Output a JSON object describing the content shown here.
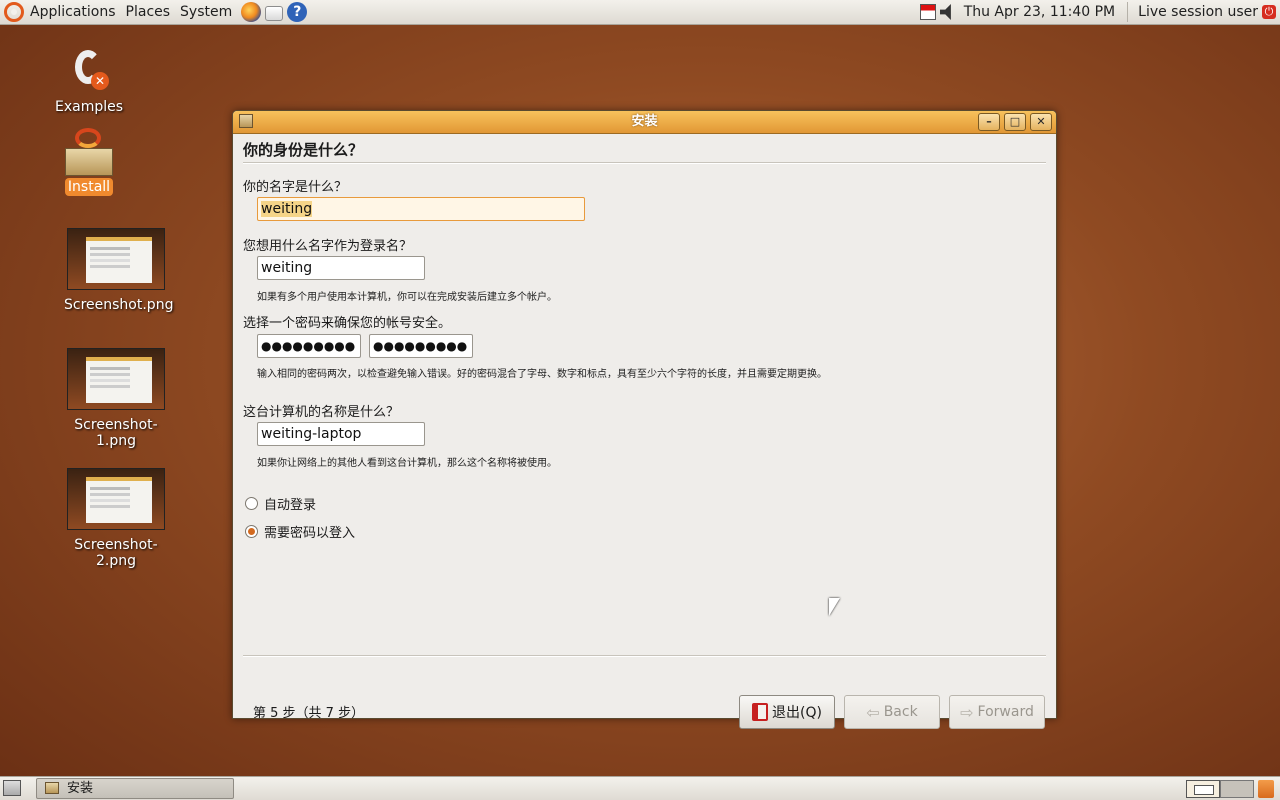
{
  "top_panel": {
    "menus": [
      "Applications",
      "Places",
      "System"
    ],
    "clock": "Thu Apr 23, 11:40 PM",
    "session": "Live session user"
  },
  "desktop_icons": [
    {
      "label": "Examples"
    },
    {
      "label": "Install"
    },
    {
      "label": "Screenshot.png"
    },
    {
      "label": "Screenshot-1.png"
    },
    {
      "label": "Screenshot-2.png"
    }
  ],
  "window": {
    "title": "安装",
    "heading": "你的身份是什么？",
    "name_label": "你的名字是什么？",
    "name_value": "weiting",
    "login_label": "您想用什么名字作为登录名？",
    "login_value": "weiting",
    "login_hint": "如果有多个用户使用本计算机，你可以在完成安装后建立多个帐户。",
    "password_label": "选择一个密码来确保您的帐号安全。",
    "password_value": "●●●●●●●●●",
    "confirm_value": "●●●●●●●●●",
    "password_hint": "输入相同的密码两次，以检查避免输入错误。好的密码混合了字母、数字和标点，具有至少六个字符的长度，并且需要定期更换。",
    "hostname_label": "这台计算机的名称是什么？",
    "hostname_value": "weiting-laptop",
    "hostname_hint": "如果你让网络上的其他人看到这台计算机，那么这个名称将被使用。",
    "radio_auto_login": "自动登录",
    "radio_require_password": "需要密码以登入",
    "selected_radio": "require_password",
    "step_text": "第 5 步（共 7 步）",
    "quit_label": "退出(Q)",
    "back_label": "Back",
    "forward_label": "Forward"
  },
  "bottom_panel": {
    "task_label": "安装"
  },
  "icons": {
    "apps": "ubuntu-logo-icon",
    "firefox": "firefox-icon",
    "mail": "mail-icon",
    "help": "help-icon",
    "power": "power-icon"
  }
}
